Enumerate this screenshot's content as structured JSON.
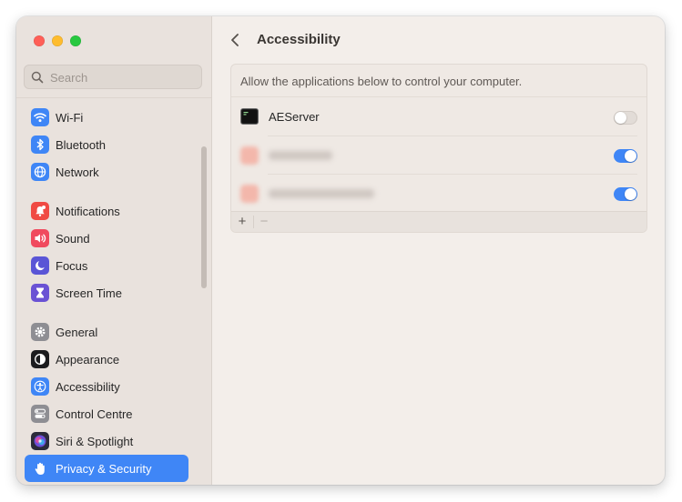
{
  "window": {
    "controls": [
      "close",
      "minimize",
      "zoom"
    ]
  },
  "sidebar": {
    "search_placeholder": "Search",
    "groups": [
      [
        {
          "label": "Wi-Fi",
          "icon": "wifi-icon",
          "color": "#3f86f6"
        },
        {
          "label": "Bluetooth",
          "icon": "bluetooth-icon",
          "color": "#3f86f6"
        },
        {
          "label": "Network",
          "icon": "globe-icon",
          "color": "#3f86f6"
        }
      ],
      [
        {
          "label": "Notifications",
          "icon": "bell-icon",
          "color": "#f04a43"
        },
        {
          "label": "Sound",
          "icon": "speaker-icon",
          "color": "#f04a5e"
        },
        {
          "label": "Focus",
          "icon": "moon-icon",
          "color": "#5a55d6"
        },
        {
          "label": "Screen Time",
          "icon": "hourglass-icon",
          "color": "#6a52d4"
        }
      ],
      [
        {
          "label": "General",
          "icon": "gear-icon",
          "color": "#8e8e93"
        },
        {
          "label": "Appearance",
          "icon": "appearance-icon",
          "color": "#1c1c1e"
        },
        {
          "label": "Accessibility",
          "icon": "accessibility-icon",
          "color": "#3f86f6"
        },
        {
          "label": "Control Centre",
          "icon": "control-centre-icon",
          "color": "#8e8e93"
        },
        {
          "label": "Siri & Spotlight",
          "icon": "siri-icon",
          "color": "#2b2b3a"
        },
        {
          "label": "Privacy & Security",
          "icon": "hand-icon",
          "color": "#3f86f6",
          "active": true
        }
      ]
    ]
  },
  "main": {
    "title": "Accessibility",
    "description": "Allow the applications below to control your computer.",
    "apps": [
      {
        "name": "AEServer",
        "enabled": false,
        "blurred": false
      },
      {
        "name": "",
        "enabled": true,
        "blurred": true
      },
      {
        "name": "",
        "enabled": true,
        "blurred": true
      }
    ],
    "add_label": "+",
    "remove_label": "−"
  },
  "colors": {
    "accent": "#3f86f6",
    "sidebar_bg": "#e9e2dd",
    "content_bg": "#f3eeea"
  }
}
